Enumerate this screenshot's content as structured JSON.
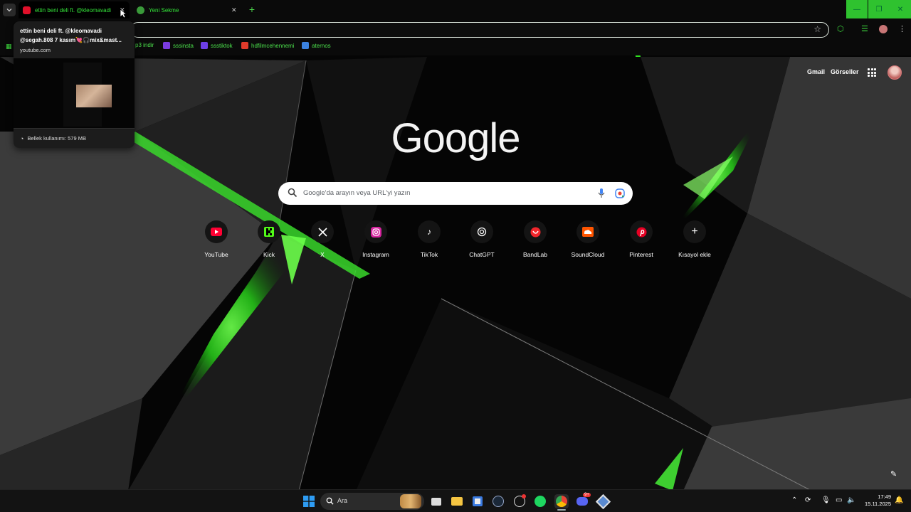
{
  "browser": {
    "tabs": [
      {
        "title": "ettin beni deli ft. @kleomavadi",
        "icon": "youtube-icon",
        "active": true
      },
      {
        "title": "Yeni Sekme",
        "icon": "chrome-icon",
        "active": false
      }
    ],
    "new_tab_label": "+",
    "bookmarks": [
      {
        "label": "p3 indir",
        "icon": "download-icon",
        "color": "#2b6be0"
      },
      {
        "label": "sssinsta",
        "icon": "sssinsta-icon",
        "color": "#7a3be0"
      },
      {
        "label": "ssstiktok",
        "icon": "ssstiktok-icon",
        "color": "#6d3fe6"
      },
      {
        "label": "hdfilmcehennemi",
        "icon": "hdfilm-icon",
        "color": "#e03b2b"
      },
      {
        "label": "aternos",
        "icon": "aternos-icon",
        "color": "#3b82e0"
      }
    ]
  },
  "hover_card": {
    "title": "ettin beni deli ft. @kleomavadi @segah.808 7 kasım💘🎧mix&mast...",
    "domain": "youtube.com",
    "memory": "Bellek kullanımı: 579 MB"
  },
  "ntp": {
    "gmail": "Gmail",
    "images": "Görseller",
    "logo": "Google",
    "search_placeholder": "Google'da arayın veya URL'yi yazın",
    "shortcuts": [
      {
        "label": "YouTube",
        "icon": "youtube-icon",
        "color": "#ff0033"
      },
      {
        "label": "Kick",
        "icon": "kick-icon",
        "color": "#53fc18"
      },
      {
        "label": "X",
        "icon": "x-icon",
        "color": "#ffffff"
      },
      {
        "label": "Instagram",
        "icon": "instagram-icon",
        "color": "#e1306c"
      },
      {
        "label": "TikTok",
        "icon": "tiktok-icon",
        "color": "#ffffff"
      },
      {
        "label": "ChatGPT",
        "icon": "chatgpt-icon",
        "color": "#ffffff"
      },
      {
        "label": "BandLab",
        "icon": "bandlab-icon",
        "color": "#f2262c"
      },
      {
        "label": "SoundCloud",
        "icon": "soundcloud-icon",
        "color": "#ff5500"
      },
      {
        "label": "Pinterest",
        "icon": "pinterest-icon",
        "color": "#e60023"
      },
      {
        "label": "Kısayol ekle",
        "icon": "plus-icon",
        "color": "#ffffff"
      }
    ]
  },
  "taskbar": {
    "search_label": "Ara",
    "time": "17:49",
    "date": "15.11.2025",
    "chat_badge": "9+"
  },
  "colors": {
    "accent_green": "#34e43a",
    "window_controls": "#2fc22f"
  }
}
